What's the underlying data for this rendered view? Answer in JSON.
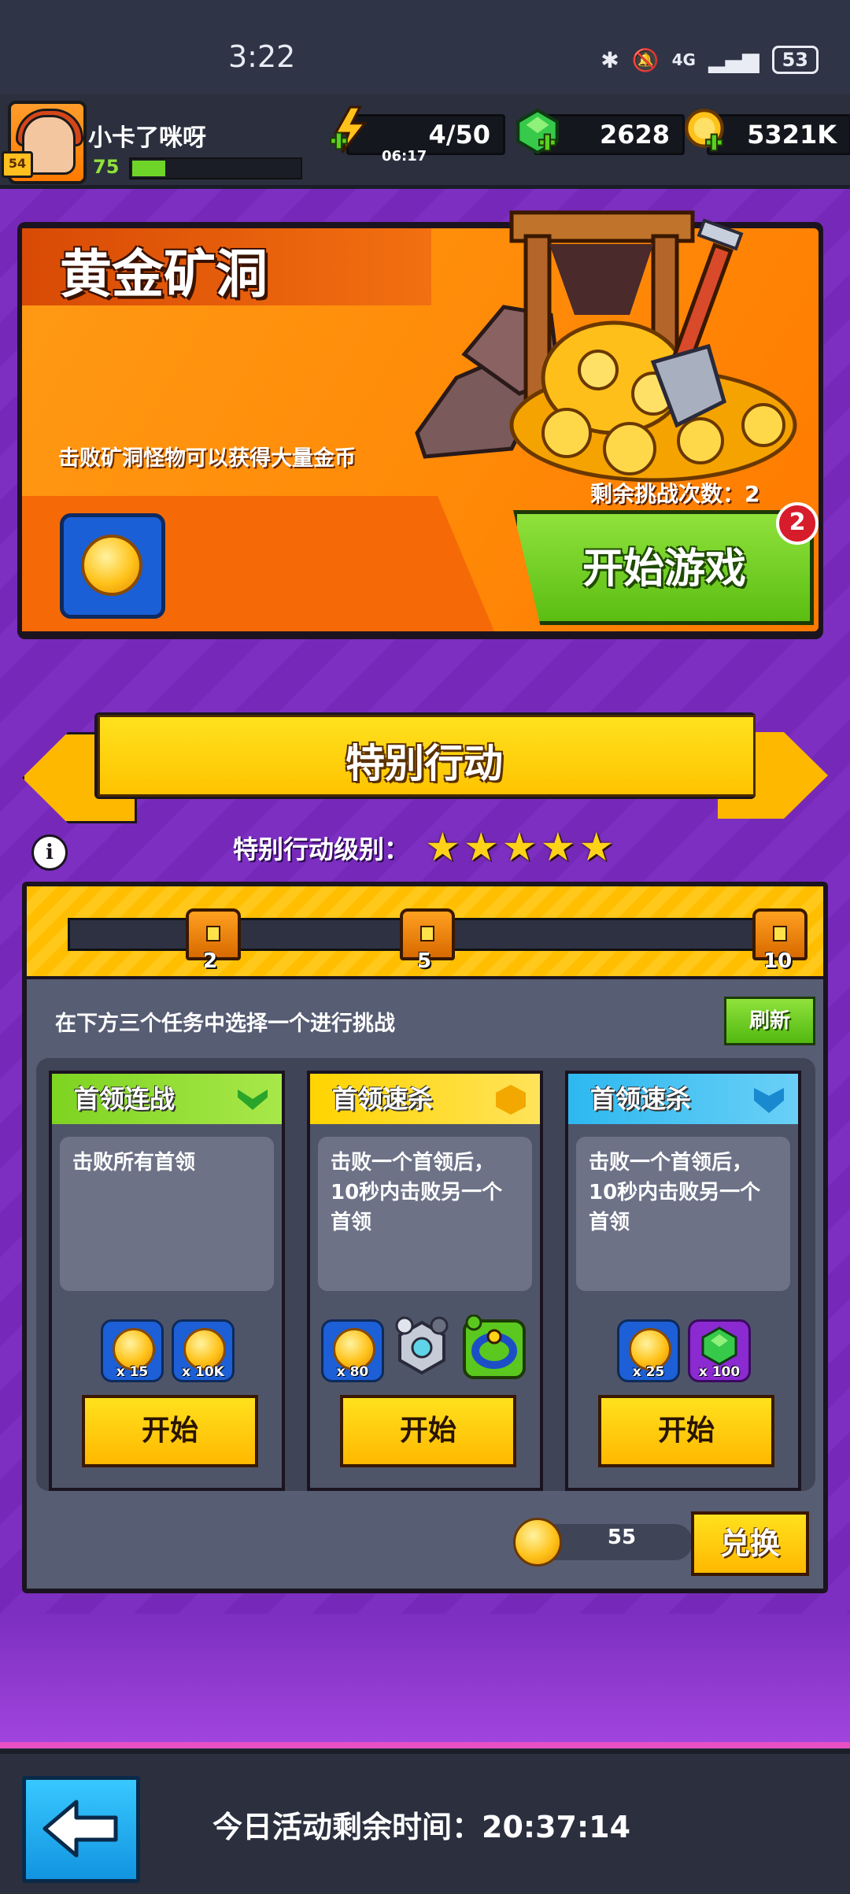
{
  "status_bar": {
    "time": "3:22",
    "battery": "53",
    "network": "4G"
  },
  "player": {
    "name": "小卡了咪呀",
    "avatar_level": "54",
    "level": "75",
    "xp_fraction": 0.2
  },
  "resources": {
    "energy": "4/50",
    "energy_timer": "06:17",
    "gems": "2628",
    "gold": "5321K"
  },
  "gold_mine": {
    "title": "黄金矿洞",
    "description": "击败矿洞怪物可以获得大量金币",
    "remaining_label": "剩余挑战次数：2",
    "start_label": "开始游戏",
    "badge": "2"
  },
  "special_action": {
    "title": "特别行动",
    "level_label": "特别行动级别：",
    "stars": 5,
    "milestones": [
      "2",
      "5",
      "10"
    ],
    "challenge_text": "在下方三个任务中选择一个进行挑战",
    "refresh_label": "刷新",
    "tasks": [
      {
        "title": "首领连战",
        "header_color": "#7ed321",
        "description": "击败所有首领",
        "rewards": [
          "x 15",
          "x 10K"
        ],
        "button": "开始"
      },
      {
        "title": "首领速杀",
        "header_color": "#ffd400",
        "description": "击败一个首领后，10秒内击败另一个首领",
        "rewards": [
          "x 80"
        ],
        "button": "开始"
      },
      {
        "title": "首领速杀",
        "header_color": "#2db8f0",
        "description": "击败一个首领后，10秒内击败另一个首领",
        "rewards": [
          "x 25",
          "x 100"
        ],
        "button": "开始"
      }
    ],
    "redeem_count": "55",
    "redeem_label": "兑换"
  },
  "bottom": {
    "timer_label": "今日活动剩余时间：20:37:14"
  },
  "icons": {
    "back": "back-arrow-icon",
    "info": "info-icon",
    "energy": "lightning-icon",
    "gems": "gem-icon",
    "gold": "gold-coin-icon"
  }
}
